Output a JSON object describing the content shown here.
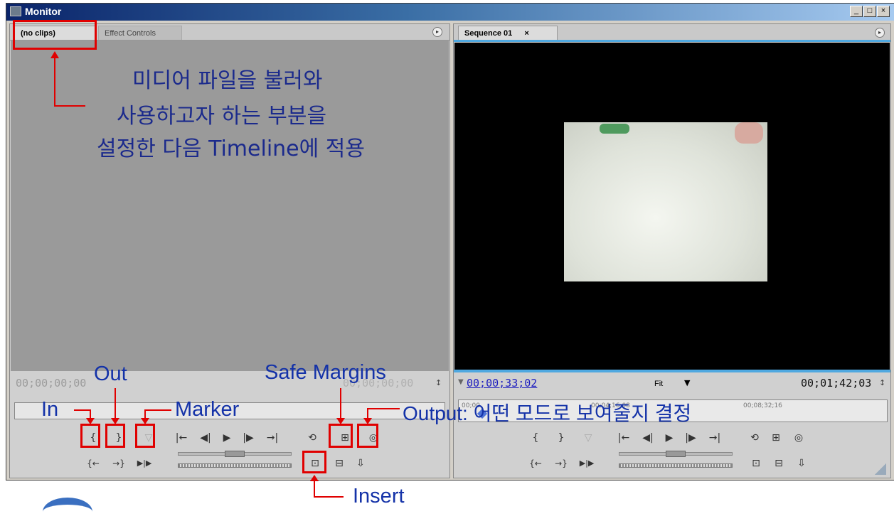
{
  "window": {
    "title": "Monitor",
    "minimize": "_",
    "maximize": "□",
    "close": "×"
  },
  "source": {
    "tabs": [
      "(no clips)",
      "Effect Controls"
    ],
    "timecode_in": "00;00;00;00",
    "timecode_out": "00;00;00;00"
  },
  "program": {
    "tab": "Sequence 01",
    "tab_close": "×",
    "timecode_current": "00;00;33;02",
    "zoom": "Fit",
    "timecode_duration": "00;01;42;03",
    "ruler_ticks": [
      "00;00",
      "00;04;16;08",
      "00;08;32;16"
    ]
  },
  "annotations": {
    "korean_line1": "미디어 파일을 불러와",
    "korean_line2": "사용하고자 하는 부분을",
    "korean_line3": "설정한 다음 Timeline에 적용",
    "in": "In",
    "out": "Out",
    "marker": "Marker",
    "safe_margins": "Safe Margins",
    "output": "Output: 어떤 모드로 보여줄지 결정",
    "insert": "Insert"
  },
  "controls": {
    "set_in": "{",
    "set_out": "}",
    "marker": "▽",
    "goto_in": "{←",
    "goto_out": "→}",
    "play_in_out": "▶|▶",
    "step_back": "◀|",
    "play": "▶",
    "step_fwd": "|▶",
    "prev_edit": "|←",
    "next_edit": "→|",
    "loop": "⟲",
    "safe": "⊞",
    "output": "◎",
    "insert": "⊡",
    "overlay": "⊟",
    "export": "⇩"
  }
}
